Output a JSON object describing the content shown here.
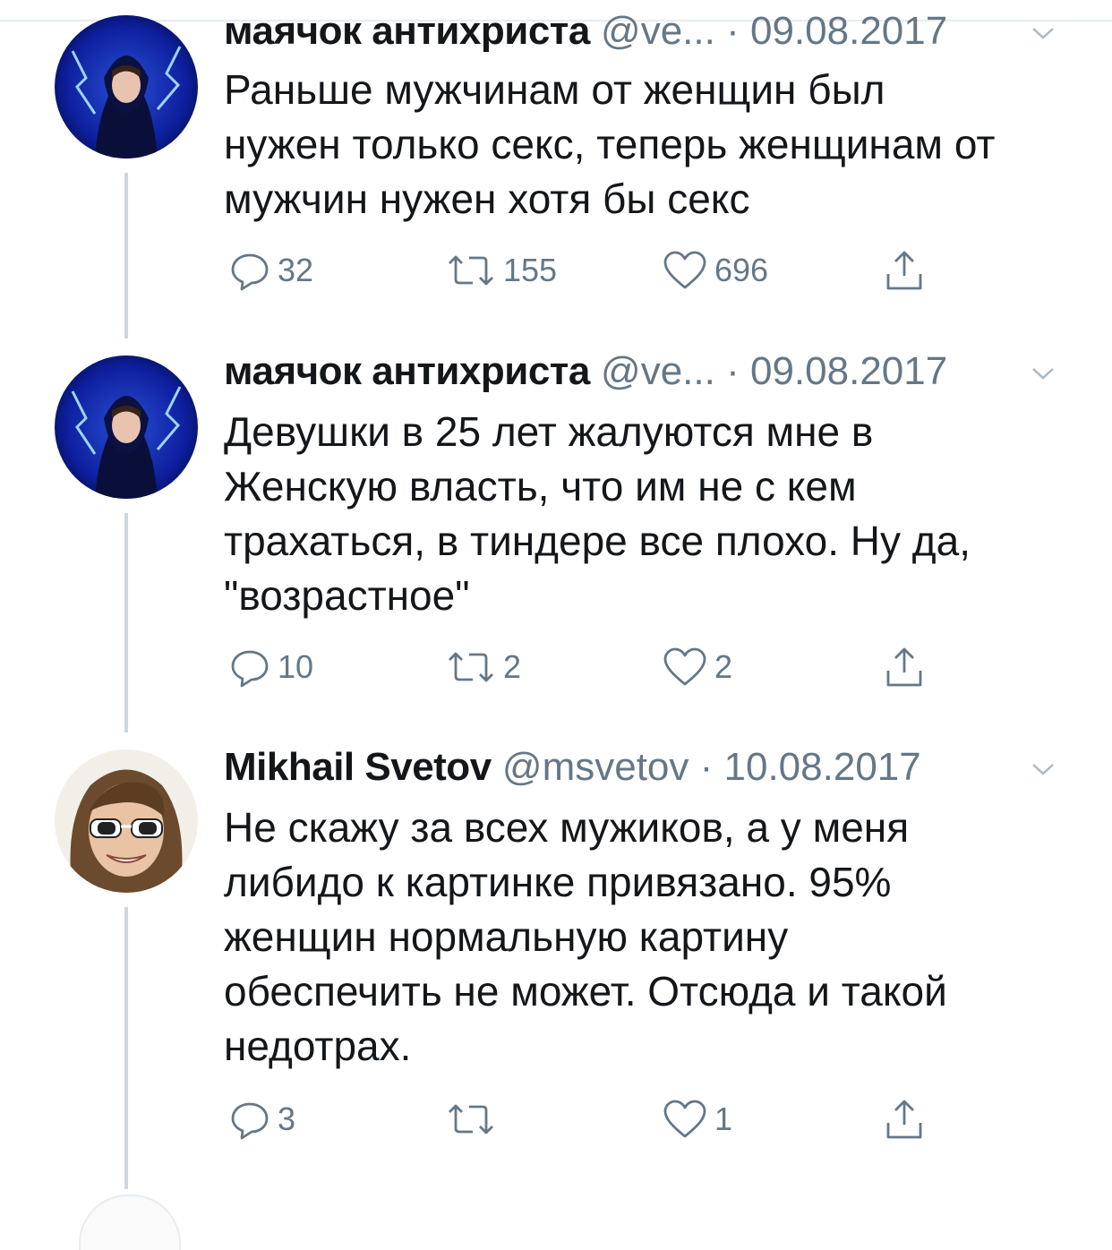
{
  "tweets": [
    {
      "name": "маячок антихриста",
      "handle": "@ve...",
      "dot": "·",
      "date": "09.08.2017",
      "text": "Раньше мужчинам от женщин был\nнужен только секс, теперь женщинам от\nмужчин нужен хотя бы секс",
      "replies": "32",
      "retweets": "155",
      "likes": "696"
    },
    {
      "name": "маячок антихриста",
      "handle": "@ve...",
      "dot": "·",
      "date": "09.08.2017",
      "text": "Девушки в 25 лет жалуются мне в\nЖенскую власть, что им не с кем\nтрахаться, в тиндере все плохо. Ну да,\n\"возрастное\"",
      "replies": "10",
      "retweets": "2",
      "likes": "2"
    },
    {
      "name": "Mikhail Svetov",
      "handle": "@msvetov",
      "dot": "·",
      "date": "10.08.2017",
      "text": "Не скажу за всех мужиков, а у меня\nлибидо к картинке привязано. 95%\nженщин нормальную картину\nобеспечить не может. Отсюда и такой\nнедотрах.",
      "replies": "3",
      "retweets": "",
      "likes": "1"
    }
  ],
  "icons": {
    "reply": "reply-icon",
    "retweet": "retweet-icon",
    "like": "heart-icon",
    "share": "share-icon",
    "more": "chevron-down-icon"
  },
  "colors": {
    "text": "#14171a",
    "secondary": "#657786",
    "divider": "#e6ecf0",
    "thread": "#ccd6dd"
  }
}
